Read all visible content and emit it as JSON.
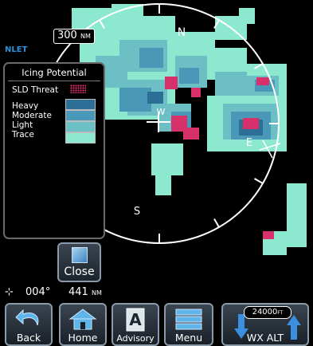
{
  "map": {
    "range_value": "300",
    "range_unit": "NM",
    "waypoint_label": "NLET",
    "compass": {
      "north": "N",
      "east": "E",
      "south": "S",
      "west": "W"
    },
    "colors": {
      "heavy": "#2d6e96",
      "moderate": "#4a98b8",
      "light": "#6cbfc5",
      "trace": "#8ce9cf",
      "sld": "#d8306a",
      "ring": "#ffffff"
    }
  },
  "legend": {
    "title": "Icing Potential",
    "sld_label": "SLD Threat",
    "levels": [
      {
        "label": "Heavy",
        "color": "#2d6e96"
      },
      {
        "label": "Moderate",
        "color": "#4a98b8"
      },
      {
        "label": "Light",
        "color": "#6cbfc5"
      },
      {
        "label": "Trace",
        "color": "#8ce9cf"
      }
    ],
    "close_label": "Close"
  },
  "status": {
    "bearing": "004°",
    "distance_value": "441",
    "distance_unit": "NM"
  },
  "toolbar": {
    "back_label": "Back",
    "home_label": "Home",
    "advisory_label": "Advisory",
    "advisory_letter": "A",
    "menu_label": "Menu",
    "wx_alt_label": "WX ALT",
    "altitude_value": "24000",
    "altitude_unit": "FT"
  }
}
